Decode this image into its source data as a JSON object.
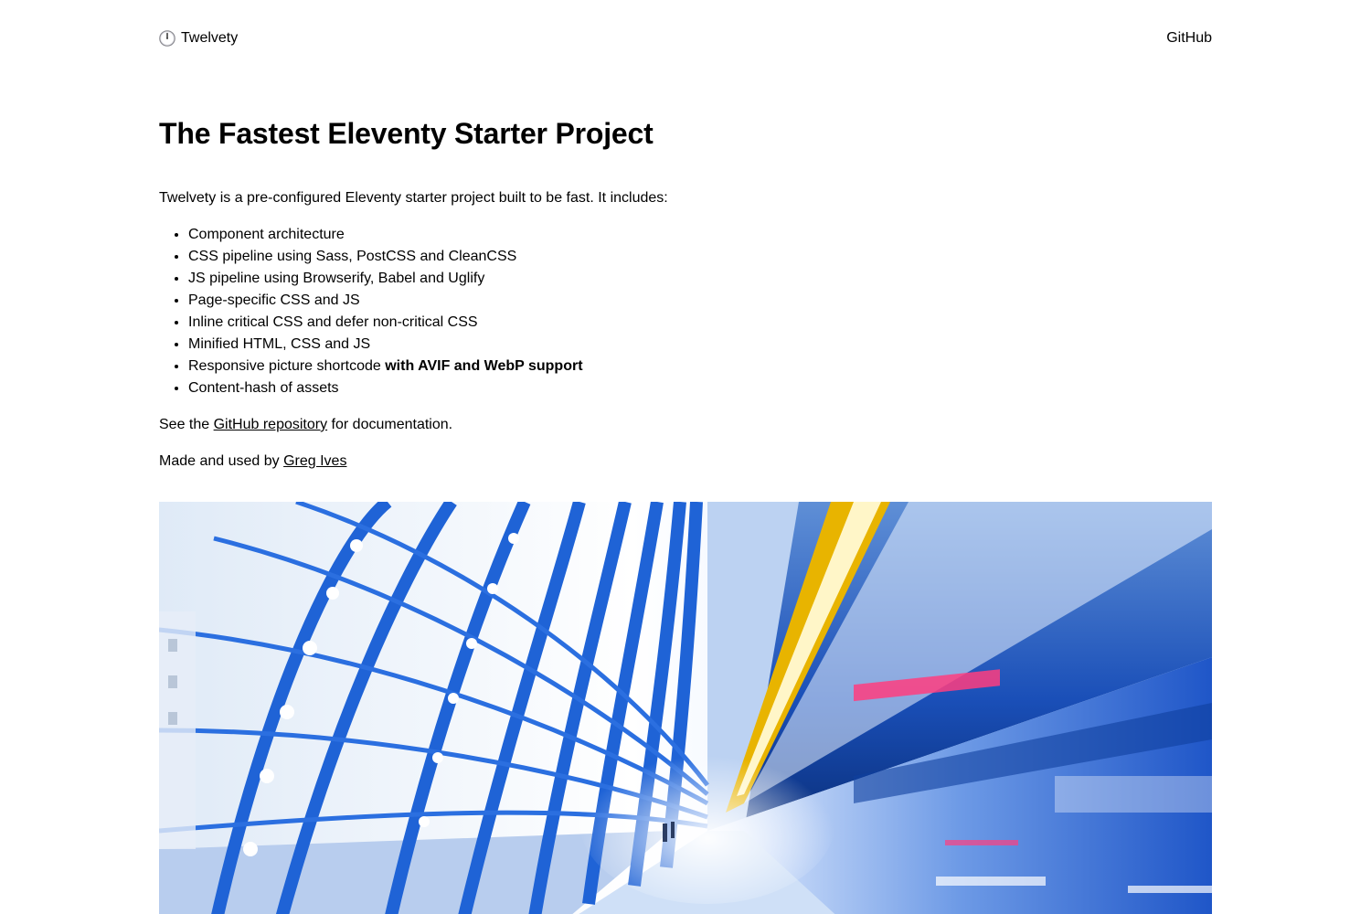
{
  "header": {
    "logo_icon": "clock-icon",
    "site_name": "Twelvety",
    "nav_github": "GitHub"
  },
  "main": {
    "title": "The Fastest Eleventy Starter Project",
    "intro": "Twelvety is a pre-configured Eleventy starter project built to be fast. It includes:",
    "features": [
      "Component architecture",
      "CSS pipeline using Sass, PostCSS and CleanCSS",
      "JS pipeline using Browserify, Babel and Uglify",
      "Page-specific CSS and JS",
      "Inline critical CSS and defer non-critical CSS",
      "Minified HTML, CSS and JS",
      {
        "prefix": "Responsive picture shortcode ",
        "bold": "with AVIF and WebP support"
      },
      "Content-hash of assets"
    ],
    "docs": {
      "before": "See the ",
      "link": "GitHub repository",
      "after": " for documentation."
    },
    "made_by": {
      "before": "Made and used by ",
      "link": "Greg Ives"
    }
  },
  "colors": {
    "text": "#000000",
    "background": "#ffffff",
    "photo_blue": "#1f63d6",
    "photo_dark": "#0a2f7a",
    "photo_yellow": "#e8b400",
    "photo_pink": "#ff3d7f"
  }
}
